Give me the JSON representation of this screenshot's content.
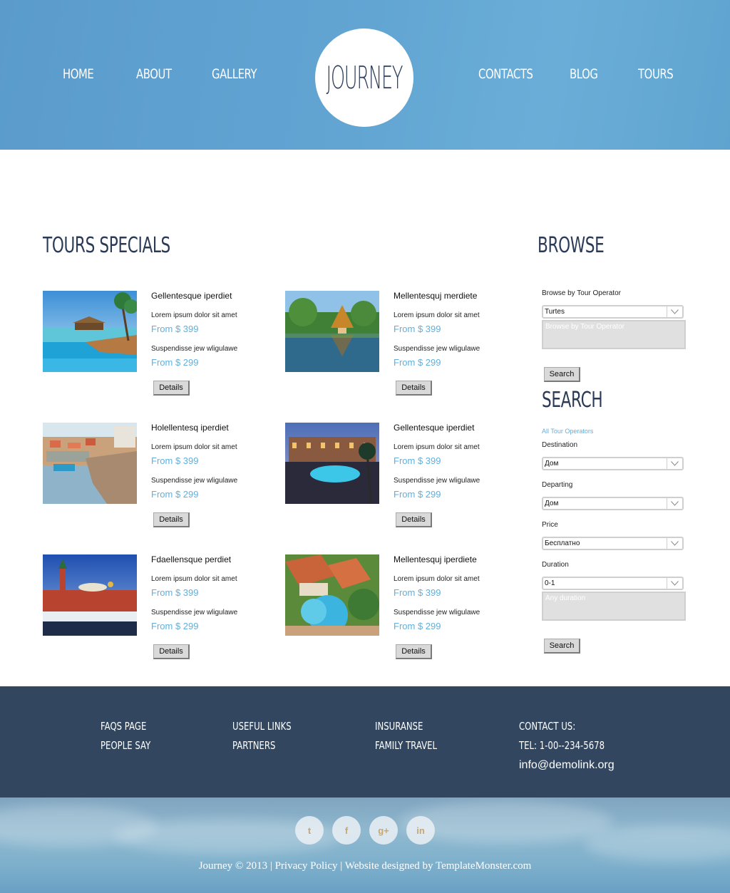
{
  "nav": {
    "left": [
      "HOME",
      "ABOUT",
      "GALLERY"
    ],
    "right": [
      "CONTACTS",
      "BLOG",
      "TOURS"
    ],
    "logo": "JOURNEY"
  },
  "tours_title": "TOURS SPECIALS",
  "tours": [
    {
      "name": "Gellentesque iperdiet",
      "line1": "Lorem ipsum dolor sit amet",
      "price1": "From $ 399",
      "line2": "Suspendisse jew wligulawe",
      "price2": "From $ 299",
      "button": "Details"
    },
    {
      "name": "Mellentesquj merdiete",
      "line1": "Lorem ipsum dolor sit amet",
      "price1": "From $ 399",
      "line2": "Suspendisse jew wligulawe",
      "price2": "From $ 299",
      "button": "Details"
    },
    {
      "name": "Holellentesq iperdiet",
      "line1": "Lorem ipsum dolor sit amet",
      "price1": "From $ 399",
      "line2": "Suspendisse jew wligulawe",
      "price2": "From $ 299",
      "button": "Details"
    },
    {
      "name": "Gellentesque iperdiet",
      "line1": "Lorem ipsum dolor sit amet",
      "price1": "From $ 399",
      "line2": "Suspendisse jew wligulawe",
      "price2": "From $ 299",
      "button": "Details"
    },
    {
      "name": "Fdaellensque perdiet",
      "line1": "Lorem ipsum dolor sit amet",
      "price1": "From $ 399",
      "line2": "Suspendisse jew wligulawe",
      "price2": "From $ 299",
      "button": "Details"
    },
    {
      "name": "Mellentesquj iperdiete",
      "line1": "Lorem ipsum dolor sit amet",
      "price1": "From $ 399",
      "line2": "Suspendisse jew wligulawe",
      "price2": "From $ 299",
      "button": "Details"
    }
  ],
  "browse": {
    "title": "BROWSE",
    "label": "Browse by Tour Operator",
    "select_value": "Turtes",
    "textarea_placeholder": "Browse by Tour Operator",
    "button": "Search"
  },
  "search": {
    "title": "SEARCH",
    "all_link": "All Tour Operators",
    "destination_label": "Destination",
    "destination_value": "Дом",
    "departing_label": "Departing",
    "departing_value": "Дом",
    "price_label": "Price",
    "price_value": "Бесплатно",
    "duration_label": "Duration",
    "duration_value": "0-1",
    "textarea_placeholder": "Any duration",
    "button": "Search"
  },
  "footer": {
    "col1": [
      "FAQS PAGE",
      "PEOPLE SAY"
    ],
    "col2": [
      "USEFUL LINKS",
      "PARTNERS"
    ],
    "col3": [
      "INSURANSE",
      "FAMILY TRAVEL"
    ],
    "contact_title": "CONTACT US:",
    "phone": "TEL: 1-00--234-5678",
    "email": "info@demolink.org"
  },
  "social": {
    "twitter": "t",
    "facebook": "f",
    "google": "g+",
    "linkedin": "in"
  },
  "copyright": {
    "brand": "Journey © 2013 |",
    "privacy": "Privacy Policy",
    "sep": "|",
    "designed": "Website designed by TemplateMonster.com"
  }
}
